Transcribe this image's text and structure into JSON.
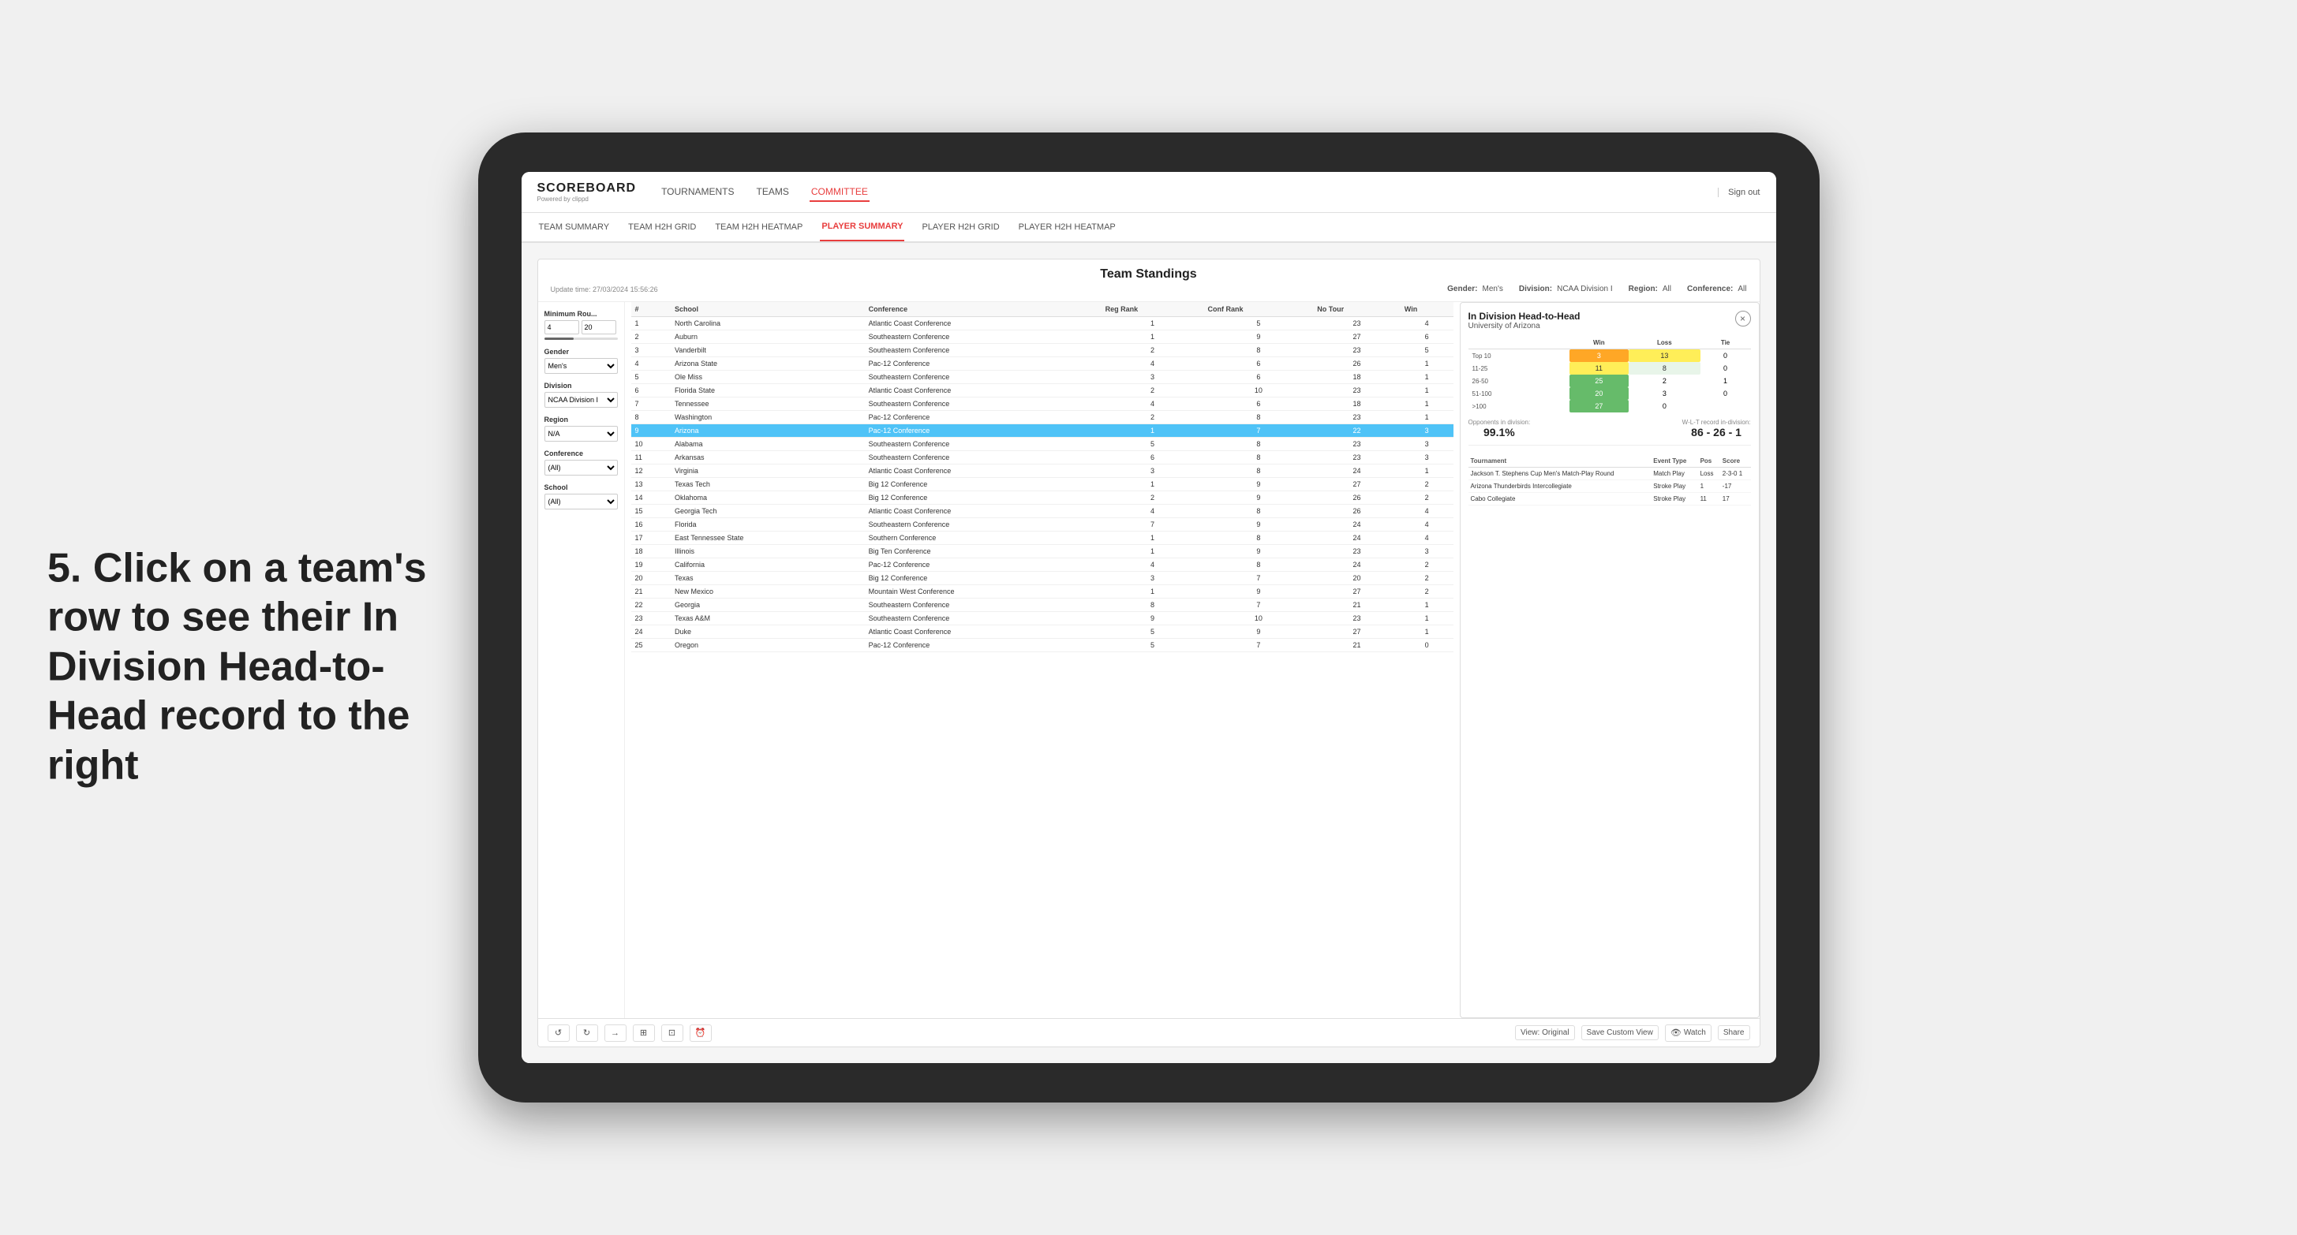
{
  "app": {
    "logo": "SCOREBOARD",
    "logo_sub": "Powered by clippd",
    "sign_out": "Sign out"
  },
  "top_nav": {
    "links": [
      {
        "label": "TOURNAMENTS",
        "active": false
      },
      {
        "label": "TEAMS",
        "active": false
      },
      {
        "label": "COMMITTEE",
        "active": true
      }
    ]
  },
  "sub_nav": {
    "links": [
      {
        "label": "TEAM SUMMARY",
        "active": false
      },
      {
        "label": "TEAM H2H GRID",
        "active": false
      },
      {
        "label": "TEAM H2H HEATMAP",
        "active": false
      },
      {
        "label": "PLAYER SUMMARY",
        "active": true
      },
      {
        "label": "PLAYER H2H GRID",
        "active": false
      },
      {
        "label": "PLAYER H2H HEATMAP",
        "active": false
      }
    ]
  },
  "panel": {
    "update_time": "Update time: 27/03/2024 15:56:26",
    "title": "Team Standings",
    "gender_label": "Gender:",
    "gender_value": "Men's",
    "division_label": "Division:",
    "division_value": "NCAA Division I",
    "region_label": "Region:",
    "region_value": "All",
    "conference_label": "Conference:",
    "conference_value": "All"
  },
  "filters": {
    "min_rou_label": "Minimum Rou...",
    "min_val1": "4",
    "min_val2": "20",
    "gender_label": "Gender",
    "gender_value": "Men's",
    "division_label": "Division",
    "division_value": "NCAA Division I",
    "region_label": "Region",
    "region_value": "N/A",
    "conference_label": "Conference",
    "conference_value": "(All)",
    "school_label": "School",
    "school_value": "(All)"
  },
  "table": {
    "headers": [
      "#",
      "School",
      "Conference",
      "Reg Rank",
      "Conf Rank",
      "No Tour",
      "Win"
    ],
    "rows": [
      {
        "num": "1",
        "school": "North Carolina",
        "conf": "Atlantic Coast Conference",
        "reg": "1",
        "crank": "5",
        "tour": "23",
        "win": "4",
        "highlight": false
      },
      {
        "num": "2",
        "school": "Auburn",
        "conf": "Southeastern Conference",
        "reg": "1",
        "crank": "9",
        "tour": "27",
        "win": "6",
        "highlight": false
      },
      {
        "num": "3",
        "school": "Vanderbilt",
        "conf": "Southeastern Conference",
        "reg": "2",
        "crank": "8",
        "tour": "23",
        "win": "5",
        "highlight": false
      },
      {
        "num": "4",
        "school": "Arizona State",
        "conf": "Pac-12 Conference",
        "reg": "4",
        "crank": "6",
        "tour": "26",
        "win": "1",
        "highlight": false
      },
      {
        "num": "5",
        "school": "Ole Miss",
        "conf": "Southeastern Conference",
        "reg": "3",
        "crank": "6",
        "tour": "18",
        "win": "1",
        "highlight": false
      },
      {
        "num": "6",
        "school": "Florida State",
        "conf": "Atlantic Coast Conference",
        "reg": "2",
        "crank": "10",
        "tour": "23",
        "win": "1",
        "highlight": false
      },
      {
        "num": "7",
        "school": "Tennessee",
        "conf": "Southeastern Conference",
        "reg": "4",
        "crank": "6",
        "tour": "18",
        "win": "1",
        "highlight": false
      },
      {
        "num": "8",
        "school": "Washington",
        "conf": "Pac-12 Conference",
        "reg": "2",
        "crank": "8",
        "tour": "23",
        "win": "1",
        "highlight": false
      },
      {
        "num": "9",
        "school": "Arizona",
        "conf": "Pac-12 Conference",
        "reg": "1",
        "crank": "7",
        "tour": "22",
        "win": "3",
        "highlight": true
      },
      {
        "num": "10",
        "school": "Alabama",
        "conf": "Southeastern Conference",
        "reg": "5",
        "crank": "8",
        "tour": "23",
        "win": "3",
        "highlight": false
      },
      {
        "num": "11",
        "school": "Arkansas",
        "conf": "Southeastern Conference",
        "reg": "6",
        "crank": "8",
        "tour": "23",
        "win": "3",
        "highlight": false
      },
      {
        "num": "12",
        "school": "Virginia",
        "conf": "Atlantic Coast Conference",
        "reg": "3",
        "crank": "8",
        "tour": "24",
        "win": "1",
        "highlight": false
      },
      {
        "num": "13",
        "school": "Texas Tech",
        "conf": "Big 12 Conference",
        "reg": "1",
        "crank": "9",
        "tour": "27",
        "win": "2",
        "highlight": false
      },
      {
        "num": "14",
        "school": "Oklahoma",
        "conf": "Big 12 Conference",
        "reg": "2",
        "crank": "9",
        "tour": "26",
        "win": "2",
        "highlight": false
      },
      {
        "num": "15",
        "school": "Georgia Tech",
        "conf": "Atlantic Coast Conference",
        "reg": "4",
        "crank": "8",
        "tour": "26",
        "win": "4",
        "highlight": false
      },
      {
        "num": "16",
        "school": "Florida",
        "conf": "Southeastern Conference",
        "reg": "7",
        "crank": "9",
        "tour": "24",
        "win": "4",
        "highlight": false
      },
      {
        "num": "17",
        "school": "East Tennessee State",
        "conf": "Southern Conference",
        "reg": "1",
        "crank": "8",
        "tour": "24",
        "win": "4",
        "highlight": false
      },
      {
        "num": "18",
        "school": "Illinois",
        "conf": "Big Ten Conference",
        "reg": "1",
        "crank": "9",
        "tour": "23",
        "win": "3",
        "highlight": false
      },
      {
        "num": "19",
        "school": "California",
        "conf": "Pac-12 Conference",
        "reg": "4",
        "crank": "8",
        "tour": "24",
        "win": "2",
        "highlight": false
      },
      {
        "num": "20",
        "school": "Texas",
        "conf": "Big 12 Conference",
        "reg": "3",
        "crank": "7",
        "tour": "20",
        "win": "2",
        "highlight": false
      },
      {
        "num": "21",
        "school": "New Mexico",
        "conf": "Mountain West Conference",
        "reg": "1",
        "crank": "9",
        "tour": "27",
        "win": "2",
        "highlight": false
      },
      {
        "num": "22",
        "school": "Georgia",
        "conf": "Southeastern Conference",
        "reg": "8",
        "crank": "7",
        "tour": "21",
        "win": "1",
        "highlight": false
      },
      {
        "num": "23",
        "school": "Texas A&M",
        "conf": "Southeastern Conference",
        "reg": "9",
        "crank": "10",
        "tour": "23",
        "win": "1",
        "highlight": false
      },
      {
        "num": "24",
        "school": "Duke",
        "conf": "Atlantic Coast Conference",
        "reg": "5",
        "crank": "9",
        "tour": "27",
        "win": "1",
        "highlight": false
      },
      {
        "num": "25",
        "school": "Oregon",
        "conf": "Pac-12 Conference",
        "reg": "5",
        "crank": "7",
        "tour": "21",
        "win": "0",
        "highlight": false
      }
    ]
  },
  "h2h": {
    "title": "In Division Head-to-Head",
    "team": "University of Arizona",
    "close_label": "×",
    "win_label": "Win",
    "loss_label": "Loss",
    "tie_label": "Tie",
    "rows": [
      {
        "range": "Top 10",
        "win": "3",
        "loss": "13",
        "tie": "0"
      },
      {
        "range": "11-25",
        "win": "11",
        "loss": "8",
        "tie": "0"
      },
      {
        "range": "26-50",
        "win": "25",
        "loss": "2",
        "tie": "1"
      },
      {
        "range": "51-100",
        "win": "20",
        "loss": "3",
        "tie": "0"
      },
      {
        "range": ">100",
        "win": "27",
        "loss": "0",
        "tie": ""
      }
    ],
    "opponents_label": "Opponents in division:",
    "opponents_value": "99.1%",
    "wlt_label": "W-L-T record in-division:",
    "wlt_value": "86 - 26 - 1",
    "tournament_headers": [
      "Tournament",
      "Event Type",
      "Pos",
      "Score"
    ],
    "tournaments": [
      {
        "name": "Jackson T. Stephens Cup Men's Match-Play Round",
        "type": "Match Play",
        "pos": "Loss",
        "score": "2-3-0 1"
      },
      {
        "name": "Arizona Thunderbirds Intercollegiate",
        "type": "Stroke Play",
        "pos": "1",
        "score": "-17"
      },
      {
        "name": "Cabo Collegiate",
        "type": "Stroke Play",
        "pos": "11",
        "score": "17"
      }
    ]
  },
  "toolbar": {
    "undo": "↺",
    "forward": "↻",
    "view_original": "View: Original",
    "save_custom": "Save Custom View",
    "watch": "Watch",
    "share": "Share"
  },
  "annotation": {
    "text": "5. Click on a team's row to see their In Division Head-to-Head record to the right"
  }
}
